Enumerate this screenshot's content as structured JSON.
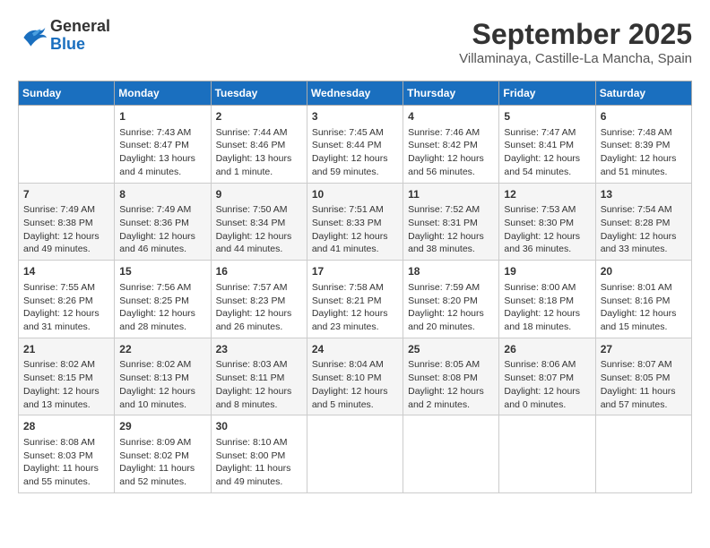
{
  "header": {
    "logo_line1": "General",
    "logo_line2": "Blue",
    "month": "September 2025",
    "location": "Villaminaya, Castille-La Mancha, Spain"
  },
  "weekdays": [
    "Sunday",
    "Monday",
    "Tuesday",
    "Wednesday",
    "Thursday",
    "Friday",
    "Saturday"
  ],
  "weeks": [
    [
      {
        "day": "",
        "info": ""
      },
      {
        "day": "1",
        "info": "Sunrise: 7:43 AM\nSunset: 8:47 PM\nDaylight: 13 hours\nand 4 minutes."
      },
      {
        "day": "2",
        "info": "Sunrise: 7:44 AM\nSunset: 8:46 PM\nDaylight: 13 hours\nand 1 minute."
      },
      {
        "day": "3",
        "info": "Sunrise: 7:45 AM\nSunset: 8:44 PM\nDaylight: 12 hours\nand 59 minutes."
      },
      {
        "day": "4",
        "info": "Sunrise: 7:46 AM\nSunset: 8:42 PM\nDaylight: 12 hours\nand 56 minutes."
      },
      {
        "day": "5",
        "info": "Sunrise: 7:47 AM\nSunset: 8:41 PM\nDaylight: 12 hours\nand 54 minutes."
      },
      {
        "day": "6",
        "info": "Sunrise: 7:48 AM\nSunset: 8:39 PM\nDaylight: 12 hours\nand 51 minutes."
      }
    ],
    [
      {
        "day": "7",
        "info": "Sunrise: 7:49 AM\nSunset: 8:38 PM\nDaylight: 12 hours\nand 49 minutes."
      },
      {
        "day": "8",
        "info": "Sunrise: 7:49 AM\nSunset: 8:36 PM\nDaylight: 12 hours\nand 46 minutes."
      },
      {
        "day": "9",
        "info": "Sunrise: 7:50 AM\nSunset: 8:34 PM\nDaylight: 12 hours\nand 44 minutes."
      },
      {
        "day": "10",
        "info": "Sunrise: 7:51 AM\nSunset: 8:33 PM\nDaylight: 12 hours\nand 41 minutes."
      },
      {
        "day": "11",
        "info": "Sunrise: 7:52 AM\nSunset: 8:31 PM\nDaylight: 12 hours\nand 38 minutes."
      },
      {
        "day": "12",
        "info": "Sunrise: 7:53 AM\nSunset: 8:30 PM\nDaylight: 12 hours\nand 36 minutes."
      },
      {
        "day": "13",
        "info": "Sunrise: 7:54 AM\nSunset: 8:28 PM\nDaylight: 12 hours\nand 33 minutes."
      }
    ],
    [
      {
        "day": "14",
        "info": "Sunrise: 7:55 AM\nSunset: 8:26 PM\nDaylight: 12 hours\nand 31 minutes."
      },
      {
        "day": "15",
        "info": "Sunrise: 7:56 AM\nSunset: 8:25 PM\nDaylight: 12 hours\nand 28 minutes."
      },
      {
        "day": "16",
        "info": "Sunrise: 7:57 AM\nSunset: 8:23 PM\nDaylight: 12 hours\nand 26 minutes."
      },
      {
        "day": "17",
        "info": "Sunrise: 7:58 AM\nSunset: 8:21 PM\nDaylight: 12 hours\nand 23 minutes."
      },
      {
        "day": "18",
        "info": "Sunrise: 7:59 AM\nSunset: 8:20 PM\nDaylight: 12 hours\nand 20 minutes."
      },
      {
        "day": "19",
        "info": "Sunrise: 8:00 AM\nSunset: 8:18 PM\nDaylight: 12 hours\nand 18 minutes."
      },
      {
        "day": "20",
        "info": "Sunrise: 8:01 AM\nSunset: 8:16 PM\nDaylight: 12 hours\nand 15 minutes."
      }
    ],
    [
      {
        "day": "21",
        "info": "Sunrise: 8:02 AM\nSunset: 8:15 PM\nDaylight: 12 hours\nand 13 minutes."
      },
      {
        "day": "22",
        "info": "Sunrise: 8:02 AM\nSunset: 8:13 PM\nDaylight: 12 hours\nand 10 minutes."
      },
      {
        "day": "23",
        "info": "Sunrise: 8:03 AM\nSunset: 8:11 PM\nDaylight: 12 hours\nand 8 minutes."
      },
      {
        "day": "24",
        "info": "Sunrise: 8:04 AM\nSunset: 8:10 PM\nDaylight: 12 hours\nand 5 minutes."
      },
      {
        "day": "25",
        "info": "Sunrise: 8:05 AM\nSunset: 8:08 PM\nDaylight: 12 hours\nand 2 minutes."
      },
      {
        "day": "26",
        "info": "Sunrise: 8:06 AM\nSunset: 8:07 PM\nDaylight: 12 hours\nand 0 minutes."
      },
      {
        "day": "27",
        "info": "Sunrise: 8:07 AM\nSunset: 8:05 PM\nDaylight: 11 hours\nand 57 minutes."
      }
    ],
    [
      {
        "day": "28",
        "info": "Sunrise: 8:08 AM\nSunset: 8:03 PM\nDaylight: 11 hours\nand 55 minutes."
      },
      {
        "day": "29",
        "info": "Sunrise: 8:09 AM\nSunset: 8:02 PM\nDaylight: 11 hours\nand 52 minutes."
      },
      {
        "day": "30",
        "info": "Sunrise: 8:10 AM\nSunset: 8:00 PM\nDaylight: 11 hours\nand 49 minutes."
      },
      {
        "day": "",
        "info": ""
      },
      {
        "day": "",
        "info": ""
      },
      {
        "day": "",
        "info": ""
      },
      {
        "day": "",
        "info": ""
      }
    ]
  ]
}
